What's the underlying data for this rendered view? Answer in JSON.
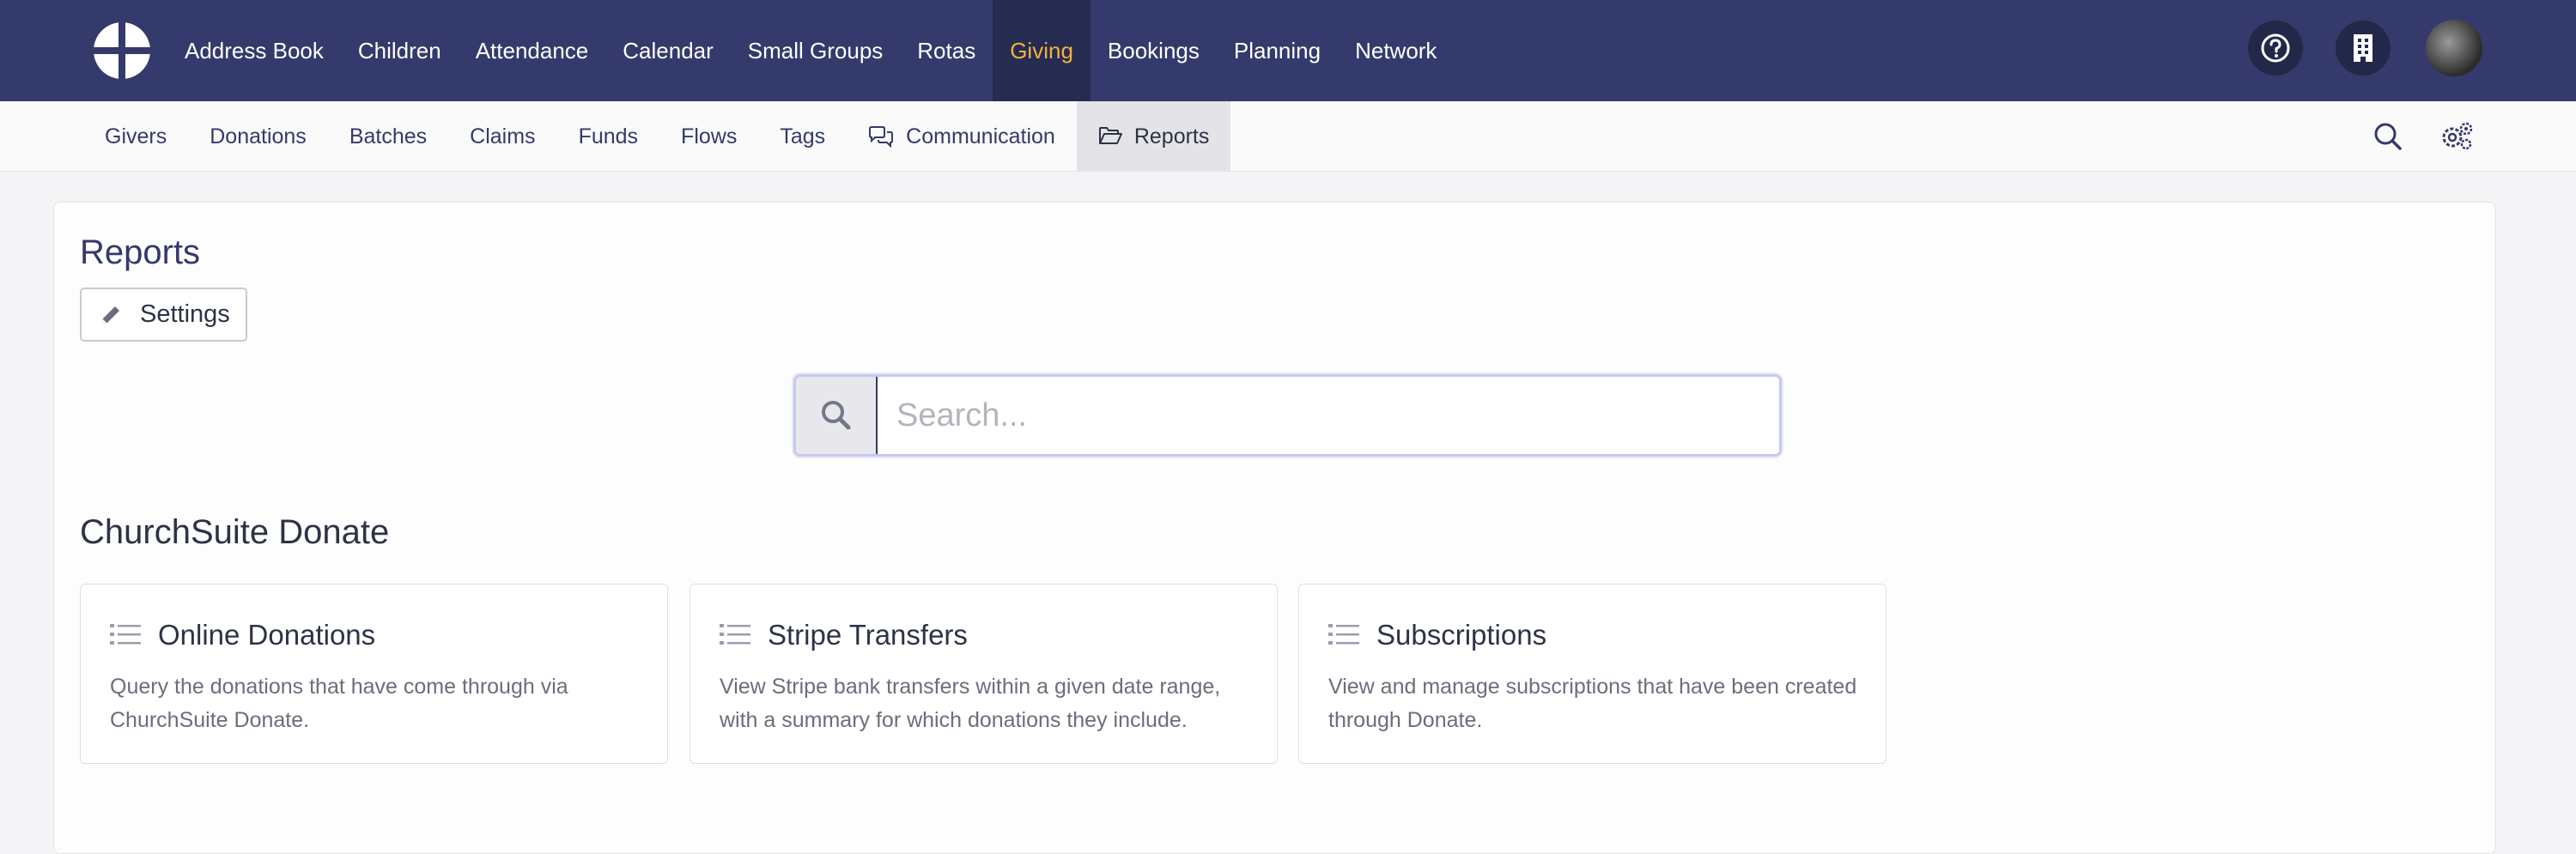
{
  "topnav": {
    "items": [
      {
        "label": "Address Book"
      },
      {
        "label": "Children"
      },
      {
        "label": "Attendance"
      },
      {
        "label": "Calendar"
      },
      {
        "label": "Small Groups"
      },
      {
        "label": "Rotas"
      },
      {
        "label": "Giving",
        "active": true
      },
      {
        "label": "Bookings"
      },
      {
        "label": "Planning"
      },
      {
        "label": "Network"
      }
    ],
    "active_color": "#f0b33c",
    "bg_color": "#343a6b"
  },
  "subnav": {
    "items": [
      {
        "label": "Givers"
      },
      {
        "label": "Donations"
      },
      {
        "label": "Batches"
      },
      {
        "label": "Claims"
      },
      {
        "label": "Funds"
      },
      {
        "label": "Flows"
      },
      {
        "label": "Tags"
      },
      {
        "label": "Communication",
        "icon": "comments-icon"
      },
      {
        "label": "Reports",
        "icon": "folder-open-icon",
        "active": true
      }
    ]
  },
  "page": {
    "title": "Reports",
    "settings_label": "Settings"
  },
  "search": {
    "placeholder": "Search..."
  },
  "section": {
    "title": "ChurchSuite Donate",
    "cards": [
      {
        "title": "Online Donations",
        "description": "Query the donations that have come through via ChurchSuite Donate."
      },
      {
        "title": "Stripe Transfers",
        "description": "View Stripe bank transfers within a given date range, with a summary for which donations they include."
      },
      {
        "title": "Subscriptions",
        "description": "View and manage subscriptions that have been created through Donate."
      }
    ]
  }
}
